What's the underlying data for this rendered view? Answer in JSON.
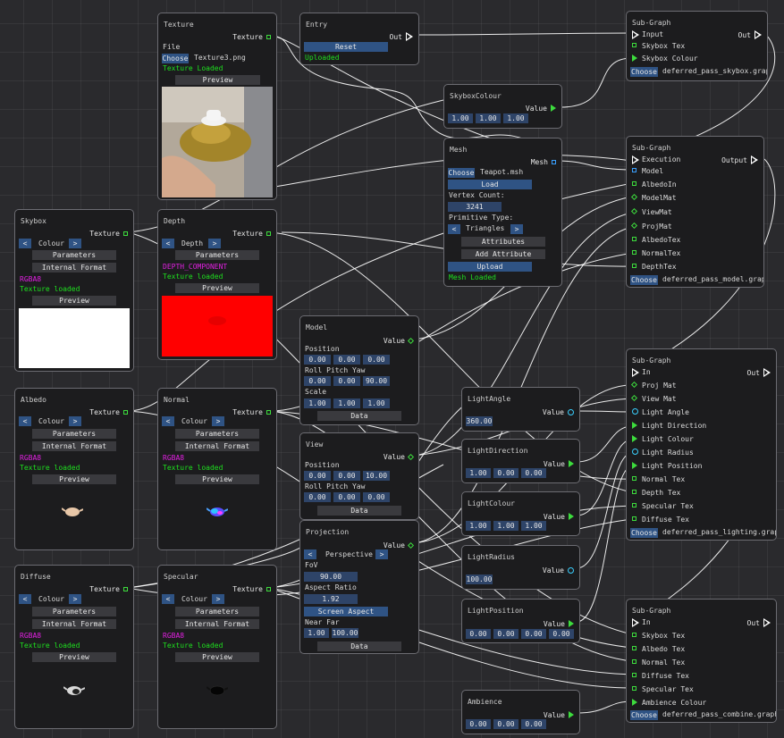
{
  "texture": {
    "title": "Texture",
    "out": "Texture",
    "file_label": "File",
    "choose": "Choose",
    "filename": "Texture3.png",
    "status": "Texture Loaded",
    "preview": "Preview"
  },
  "entry": {
    "title": "Entry",
    "out": "Out",
    "reset": "Reset",
    "status": "Uploaded"
  },
  "subgraph1": {
    "title": "Sub-Graph",
    "inputs": [
      "Input",
      "Skybox Tex",
      "Skybox Colour"
    ],
    "out": "Out",
    "choose": "Choose",
    "file": "deferred_pass_skybox.graph"
  },
  "skyboxcolour": {
    "title": "SkyboxColour",
    "out": "Value",
    "values": [
      "1.00",
      "1.00",
      "1.00"
    ]
  },
  "mesh": {
    "title": "Mesh",
    "out": "Mesh",
    "choose": "Choose",
    "filename": "Teapot.msh",
    "load": "Load",
    "vertex_label": "Vertex Count:",
    "vertex_count": "3241",
    "prim_label": "Primitive Type:",
    "prim_prev": "<",
    "prim_value": "Triangles",
    "prim_next": ">",
    "attributes": "Attributes",
    "add_attribute": "Add Attribute",
    "upload": "Upload",
    "status": "Mesh Loaded"
  },
  "subgraph2": {
    "title": "Sub-Graph",
    "inputs": [
      "Execution",
      "Model",
      "AlbedoIn",
      "ModelMat",
      "ViewMat",
      "ProjMat",
      "AlbedoTex",
      "NormalTex",
      "DepthTex"
    ],
    "out": "Output",
    "choose": "Choose",
    "file": "deferred_pass_model.graph"
  },
  "skybox": {
    "title": "Skybox",
    "out": "Texture",
    "prev": "<",
    "mode": "Colour",
    "next": ">",
    "parameters": "Parameters",
    "internal_format": "Internal Format",
    "format": "RGBA8",
    "status": "Texture loaded",
    "preview": "Preview"
  },
  "depth": {
    "title": "Depth",
    "out": "Texture",
    "prev": "<",
    "mode": "Depth",
    "next": ">",
    "parameters": "Parameters",
    "format": "DEPTH_COMPONENT",
    "status": "Texture loaded",
    "preview": "Preview"
  },
  "model": {
    "title": "Model",
    "out": "Value",
    "pos_label": "Position",
    "pos": [
      "0.00",
      "0.00",
      "0.00"
    ],
    "rot_labels": "Roll   Pitch  Yaw",
    "rot": [
      "0.00",
      "0.00",
      "90.00"
    ],
    "scale_label": "Scale",
    "scale": [
      "1.00",
      "1.00",
      "1.00"
    ],
    "data": "Data"
  },
  "albedo": {
    "title": "Albedo",
    "out": "Texture",
    "prev": "<",
    "mode": "Colour",
    "next": ">",
    "parameters": "Parameters",
    "internal_format": "Internal Format",
    "format": "RGBA8",
    "status": "Texture loaded",
    "preview": "Preview"
  },
  "normal": {
    "title": "Normal",
    "out": "Texture",
    "prev": "<",
    "mode": "Colour",
    "next": ">",
    "parameters": "Parameters",
    "internal_format": "Internal Format",
    "format": "RGBA8",
    "status": "Texture loaded",
    "preview": "Preview"
  },
  "view": {
    "title": "View",
    "out": "Value",
    "pos_label": "Position",
    "pos": [
      "0.00",
      "0.00",
      "10.00"
    ],
    "rot_labels": "Roll   Pitch  Yaw",
    "rot": [
      "0.00",
      "0.00",
      "0.00"
    ],
    "data": "Data"
  },
  "lightangle": {
    "title": "LightAngle",
    "out": "Value",
    "value": "360.00"
  },
  "lightdirection": {
    "title": "LightDirection",
    "out": "Value",
    "values": [
      "1.00",
      "0.00",
      "0.00"
    ]
  },
  "lightcolour": {
    "title": "LightColour",
    "out": "Value",
    "values": [
      "1.00",
      "1.00",
      "1.00"
    ]
  },
  "lightradius": {
    "title": "LightRadius",
    "out": "Value",
    "value": "100.00"
  },
  "lightposition": {
    "title": "LightPosition",
    "out": "Value",
    "values": [
      "0.00",
      "0.00",
      "0.00",
      "0.00"
    ]
  },
  "ambience": {
    "title": "Ambience",
    "out": "Value",
    "values": [
      "0.00",
      "0.00",
      "0.00"
    ]
  },
  "projection": {
    "title": "Projection",
    "out": "Value",
    "prev": "<",
    "mode": "Perspective",
    "next": ">",
    "fov_label": "FoV",
    "fov": "90.00",
    "aspect_label": "Aspect Ratio",
    "aspect": "1.92",
    "screen_aspect": "Screen Aspect",
    "nearfar_label": "Near   Far",
    "near": "1.00",
    "far": "100.00",
    "data": "Data"
  },
  "subgraph3": {
    "title": "Sub-Graph",
    "inputs": [
      "In",
      "Proj Mat",
      "View Mat",
      "Light Angle",
      "Light Direction",
      "Light Colour",
      "Light Radius",
      "Light Position",
      "Normal Tex",
      "Depth Tex",
      "Specular Tex",
      "Diffuse Tex"
    ],
    "out": "Out",
    "choose": "Choose",
    "file": "deferred_pass_lighting.graph"
  },
  "diffuse": {
    "title": "Diffuse",
    "out": "Texture",
    "prev": "<",
    "mode": "Colour",
    "next": ">",
    "parameters": "Parameters",
    "internal_format": "Internal Format",
    "format": "RGBA8",
    "status": "Texture loaded",
    "preview": "Preview"
  },
  "specular": {
    "title": "Specular",
    "out": "Texture",
    "prev": "<",
    "mode": "Colour",
    "next": ">",
    "parameters": "Parameters",
    "internal_format": "Internal Format",
    "format": "RGBA8",
    "status": "Texture loaded",
    "preview": "Preview"
  },
  "subgraph4": {
    "title": "Sub-Graph",
    "inputs": [
      "In",
      "Skybox Tex",
      "Albedo Tex",
      "Normal Tex",
      "Diffuse Tex",
      "Specular Tex",
      "Ambience Colour"
    ],
    "out": "Out",
    "choose": "Choose",
    "file": "deferred_pass_combine.graph"
  },
  "colors": {
    "background": "#2a2a2d",
    "node": "#1c1c1e",
    "border": "#6c6c72",
    "button": "#3a3a3e",
    "button_blue": "#2f5384",
    "field": "#2e4468",
    "green": "#1ee01e",
    "magenta": "#e020e0",
    "pin_green": "#3ddc3d",
    "pin_cyan": "#3ad0ff",
    "depth_preview": "#ff0000"
  }
}
